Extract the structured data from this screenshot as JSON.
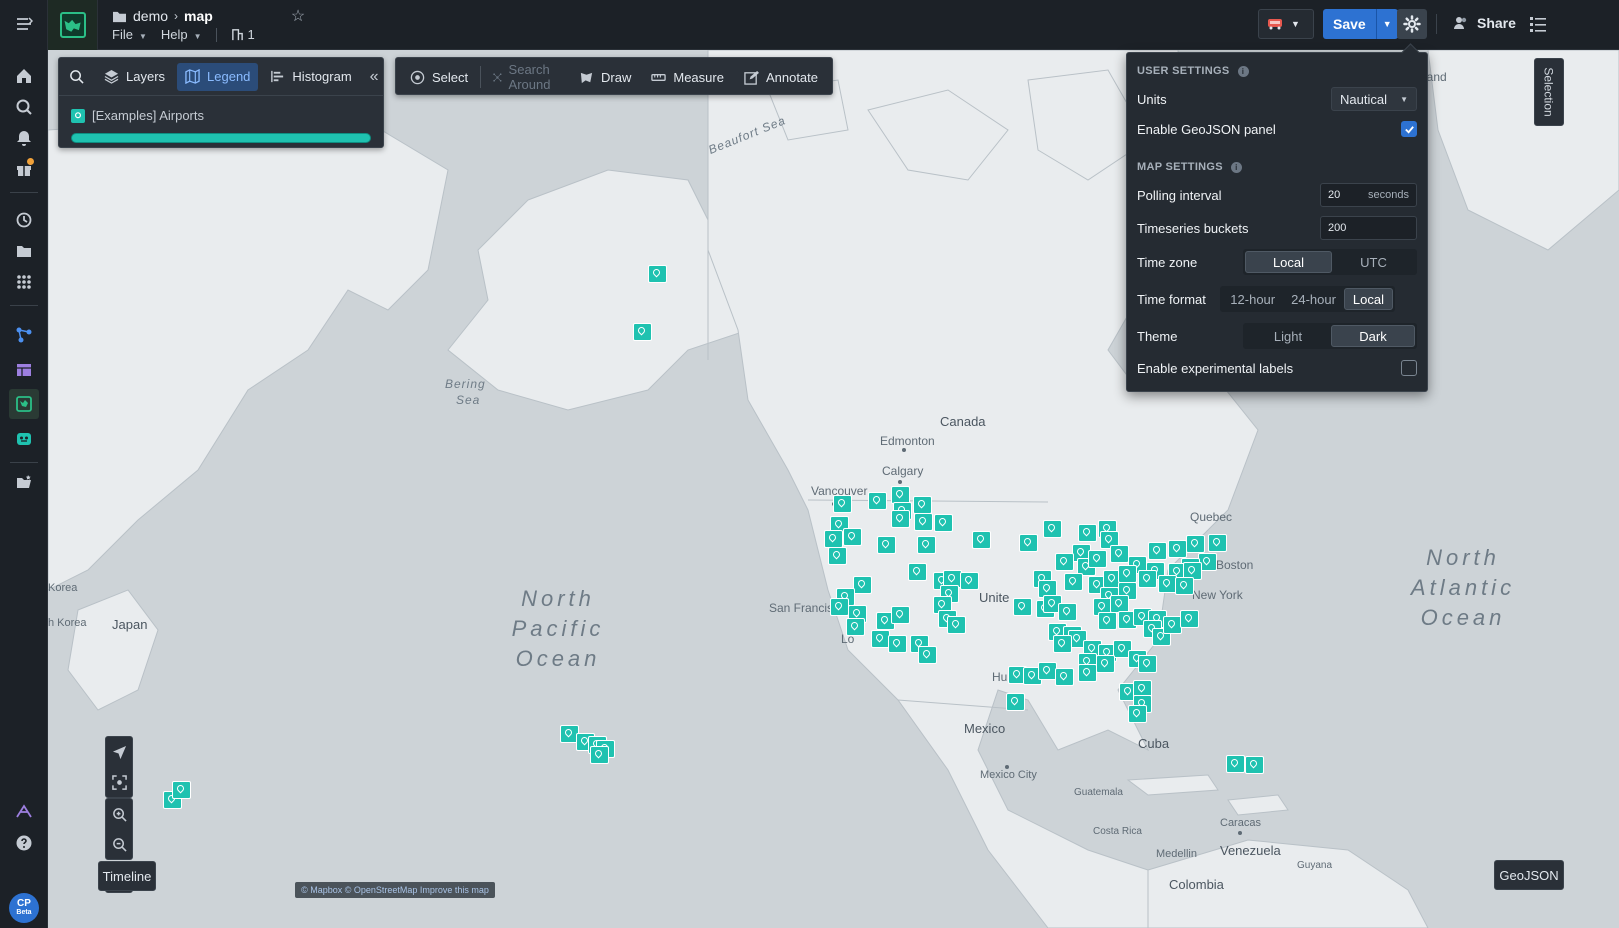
{
  "breadcrumb": {
    "folder": "demo",
    "current": "map"
  },
  "menus": {
    "file": "File",
    "help": "Help",
    "resource_count": "1"
  },
  "topbar": {
    "save": "Save",
    "share": "Share"
  },
  "map_tools": {
    "layers": "Layers",
    "legend": "Legend",
    "histogram": "Histogram",
    "select": "Select",
    "search_around": "Search Around",
    "draw": "Draw",
    "measure": "Measure",
    "annotate": "Annotate"
  },
  "legend": {
    "layer_name": "[Examples] Airports",
    "fill_fraction": 1.0
  },
  "settings": {
    "user_header": "USER SETTINGS",
    "units_label": "Units",
    "units_value": "Nautical",
    "geojson_label": "Enable GeoJSON panel",
    "geojson_enabled": true,
    "map_header": "MAP SETTINGS",
    "polling_label": "Polling interval",
    "polling_value": "20",
    "polling_unit": "seconds",
    "buckets_label": "Timeseries buckets",
    "buckets_value": "200",
    "timezone_label": "Time zone",
    "timezone_options": [
      "Local",
      "UTC"
    ],
    "timezone_selected": "Local",
    "timeformat_label": "Time format",
    "timeformat_options": [
      "12-hour",
      "24-hour",
      "Local"
    ],
    "timeformat_selected": "Local",
    "theme_label": "Theme",
    "theme_options": [
      "Light",
      "Dark"
    ],
    "theme_selected": "Dark",
    "experimental_label": "Enable experimental labels",
    "experimental_enabled": false
  },
  "side_tab": "Selection",
  "timeline": "Timeline",
  "geojson_button": "GeoJSON",
  "attribution": "© Mapbox © OpenStreetMap Improve this map",
  "avatar": {
    "initials": "CP",
    "badge": "Beta"
  },
  "map_labels": {
    "beaufort": "Beaufort Sea",
    "bering_1": "Bering",
    "bering_2": "Sea",
    "canada": "Canada",
    "edmonton": "Edmonton",
    "calgary": "Calgary",
    "vancouver": "Vancouver",
    "quebec": "Quebec",
    "boston": "Boston",
    "new_york": "New York",
    "san_francisco": "San Francisco",
    "united": "Unite",
    "los": "Lo",
    "us": "s",
    "hu": "Hu",
    "mexico": "Mexico",
    "mexico_city": "Mexico City",
    "cuba": "Cuba",
    "guatemala": "Guatemala",
    "costa_rica": "Costa Rica",
    "caracas": "Caracas",
    "venezuela": "Venezuela",
    "guyana": "Guyana",
    "medellin": "Medellin",
    "colombia": "Colombia",
    "japan": "Japan",
    "korea": "Korea",
    "n_korea": "h Korea",
    "greenland": "land",
    "npo_1": "North",
    "npo_2": "Pacific",
    "npo_3": "Ocean",
    "nao_1": "North",
    "nao_2": "Atlantic",
    "nao_3": "Ocean"
  },
  "colors": {
    "pin": "#1fc2b0",
    "accent": "#2d72d2",
    "chrome": "#1c2127"
  },
  "icons": [
    "menu-icon",
    "home-icon",
    "search-icon",
    "bell-icon",
    "gift-icon",
    "history-icon",
    "folder-icon",
    "apps-icon",
    "graph-icon",
    "table-icon",
    "map-icon",
    "bot-icon",
    "star-icon",
    "gear-icon",
    "list-icon"
  ]
}
